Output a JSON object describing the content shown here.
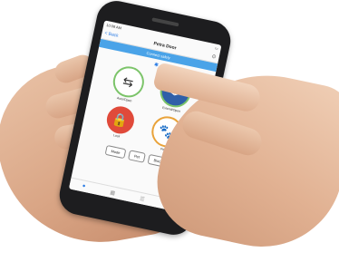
{
  "app": {
    "status_time": "10:08 AM",
    "back_label": "< Back",
    "title": "Petra Door",
    "settings_icon": "gear-icon",
    "banner_text": "Connect safely",
    "bluetooth_icon": "bluetooth-icon"
  },
  "modes": [
    {
      "icon": "arrows-icon",
      "label": "Auto/Open",
      "symbol": "⇆"
    },
    {
      "icon": "split-arrows-icon",
      "label": "Extend/Open",
      "symbol": "◀▶"
    },
    {
      "icon": "lock-icon",
      "label": "Lock",
      "symbol": "🔒"
    },
    {
      "icon": "paw-icon",
      "label": "Pet",
      "symbol": "🐾"
    }
  ],
  "buttons": {
    "mode": "Mode",
    "pet": "Pet",
    "block": "Block"
  },
  "tabs": [
    {
      "icon": "home-icon",
      "symbol": "●"
    },
    {
      "icon": "grid-icon",
      "symbol": "▦"
    },
    {
      "icon": "list-icon",
      "symbol": "☰"
    },
    {
      "icon": "more-icon",
      "symbol": "⋯"
    }
  ]
}
